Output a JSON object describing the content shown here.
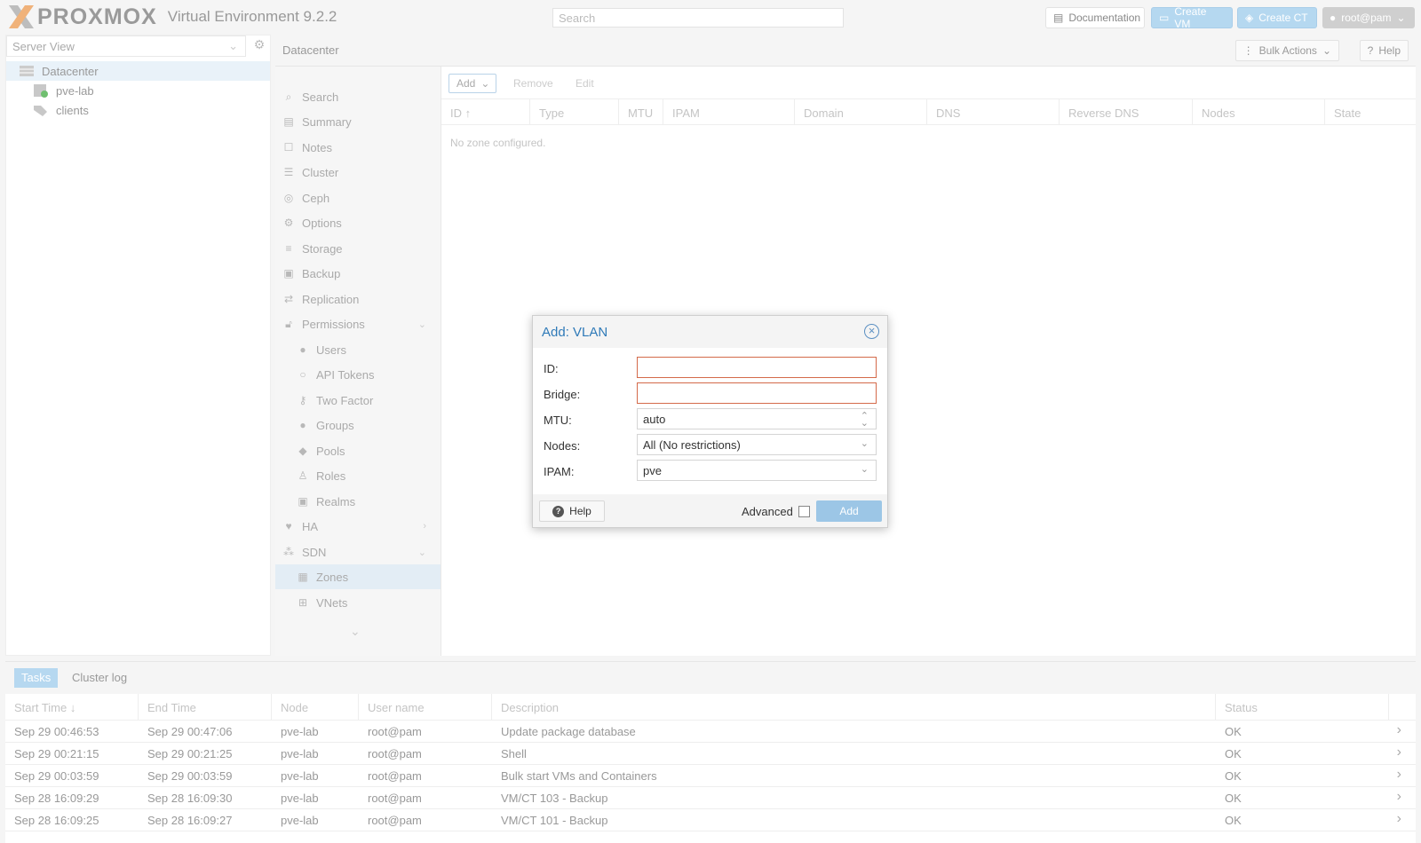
{
  "header": {
    "brand": "PROXMOX",
    "version": "Virtual Environment 9.2.2",
    "search_placeholder": "Search",
    "documentation": "Documentation",
    "create_vm": "Create VM",
    "create_ct": "Create CT",
    "user": "root@pam"
  },
  "tree": {
    "view": "Server View",
    "items": [
      {
        "label": "Datacenter",
        "icon": "datacenter-icon"
      },
      {
        "label": "pve-lab",
        "icon": "node-online-icon"
      },
      {
        "label": "clients",
        "icon": "tags-icon"
      }
    ]
  },
  "breadcrumb": "Datacenter",
  "bulk_actions": "Bulk Actions",
  "help": "Help",
  "nav": [
    {
      "label": "Search",
      "icon": "search-icon"
    },
    {
      "label": "Summary",
      "icon": "book-icon"
    },
    {
      "label": "Notes",
      "icon": "note-icon"
    },
    {
      "label": "Cluster",
      "icon": "server-icon"
    },
    {
      "label": "Ceph",
      "icon": "ceph-icon"
    },
    {
      "label": "Options",
      "icon": "gear-icon"
    },
    {
      "label": "Storage",
      "icon": "database-icon"
    },
    {
      "label": "Backup",
      "icon": "floppy-icon"
    },
    {
      "label": "Replication",
      "icon": "retweet-icon"
    },
    {
      "label": "Permissions",
      "icon": "unlock-icon"
    },
    {
      "label": "Users",
      "icon": "user-icon"
    },
    {
      "label": "API Tokens",
      "icon": "user-outline-icon"
    },
    {
      "label": "Two Factor",
      "icon": "key-icon"
    },
    {
      "label": "Groups",
      "icon": "users-icon"
    },
    {
      "label": "Pools",
      "icon": "tags-icon"
    },
    {
      "label": "Roles",
      "icon": "male-icon"
    },
    {
      "label": "Realms",
      "icon": "address-book-icon"
    },
    {
      "label": "HA",
      "icon": "heartbeat-icon"
    },
    {
      "label": "SDN",
      "icon": "sdn-icon"
    },
    {
      "label": "Zones",
      "icon": "grid-icon"
    },
    {
      "label": "VNets",
      "icon": "network-icon"
    }
  ],
  "zones": {
    "toolbar": {
      "add": "Add",
      "remove": "Remove",
      "edit": "Edit"
    },
    "columns": [
      "ID",
      "Type",
      "MTU",
      "IPAM",
      "Domain",
      "DNS",
      "Reverse DNS",
      "Nodes",
      "State"
    ],
    "empty": "No zone configured."
  },
  "dialog": {
    "title": "Add: VLAN",
    "fields": {
      "id_label": "ID:",
      "id_value": "",
      "bridge_label": "Bridge:",
      "bridge_value": "",
      "mtu_label": "MTU:",
      "mtu_value": "auto",
      "nodes_label": "Nodes:",
      "nodes_value": "All (No restrictions)",
      "ipam_label": "IPAM:",
      "ipam_value": "pve"
    },
    "help": "Help",
    "advanced": "Advanced",
    "add": "Add"
  },
  "tasks": {
    "tabs": [
      "Tasks",
      "Cluster log"
    ],
    "columns": [
      "Start Time",
      "End Time",
      "Node",
      "User name",
      "Description",
      "Status"
    ],
    "rows": [
      [
        "Sep 29 00:46:53",
        "Sep 29 00:47:06",
        "pve-lab",
        "root@pam",
        "Update package database",
        "OK"
      ],
      [
        "Sep 29 00:21:15",
        "Sep 29 00:21:25",
        "pve-lab",
        "root@pam",
        "Shell",
        "OK"
      ],
      [
        "Sep 29 00:03:59",
        "Sep 29 00:03:59",
        "pve-lab",
        "root@pam",
        "Bulk start VMs and Containers",
        "OK"
      ],
      [
        "Sep 28 16:09:29",
        "Sep 28 16:09:30",
        "pve-lab",
        "root@pam",
        "VM/CT 103 - Backup",
        "OK"
      ],
      [
        "Sep 28 16:09:25",
        "Sep 28 16:09:27",
        "pve-lab",
        "root@pam",
        "VM/CT 101 - Backup",
        "OK"
      ]
    ]
  },
  "colors": {
    "accent": "#2f7ab8",
    "brand_orange": "#e57000",
    "invalid": "#d46a4a"
  }
}
